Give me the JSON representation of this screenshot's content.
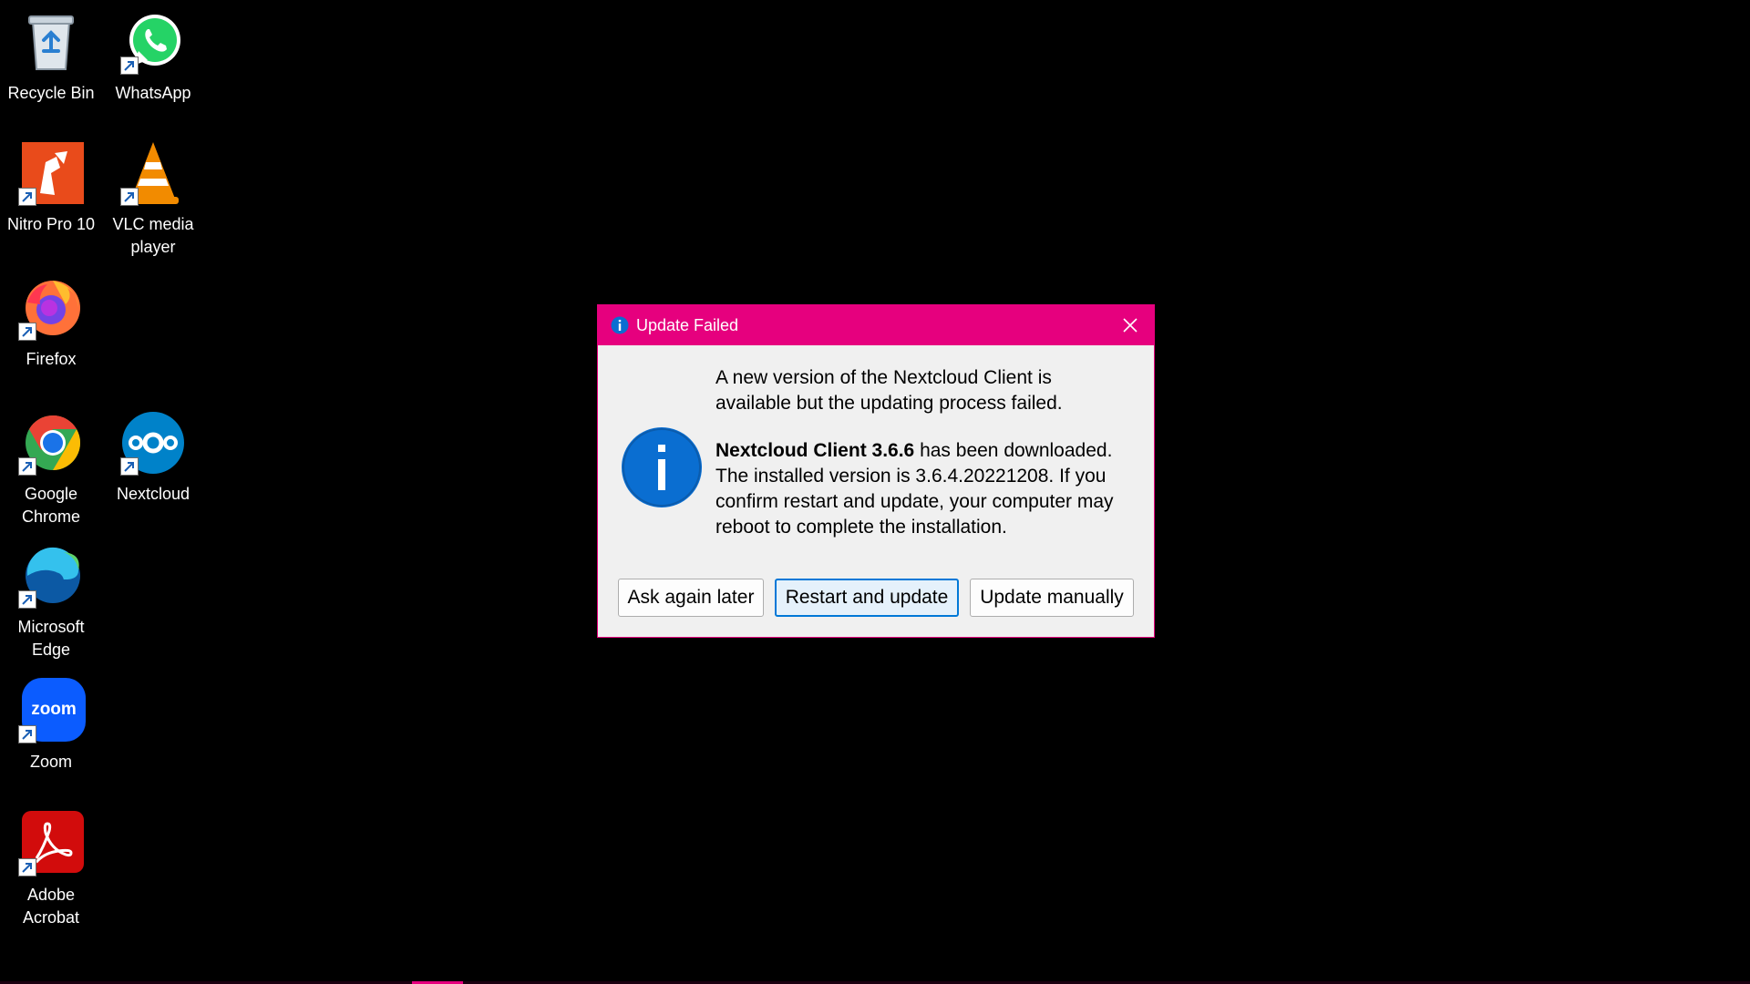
{
  "desktop": {
    "icons": [
      {
        "label": "Recycle Bin",
        "icon": "recycle-bin-icon"
      },
      {
        "label": "WhatsApp",
        "icon": "whatsapp-icon"
      },
      {
        "label": "Nitro Pro 10",
        "icon": "nitro-pro-icon"
      },
      {
        "label": "VLC media player",
        "icon": "vlc-icon"
      },
      {
        "label": "Firefox",
        "icon": "firefox-icon"
      },
      {
        "label": "Google Chrome",
        "icon": "chrome-icon"
      },
      {
        "label": "Nextcloud",
        "icon": "nextcloud-icon"
      },
      {
        "label": "Microsoft Edge",
        "icon": "edge-icon"
      },
      {
        "label": "Zoom",
        "icon": "zoom-icon"
      },
      {
        "label": "Adobe Acrobat",
        "icon": "acrobat-icon"
      }
    ],
    "zoom_logo_text": "zoom"
  },
  "dialog": {
    "title": "Update Failed",
    "message_line1": "A new version of the Nextcloud Client is available but the updating process failed.",
    "product_bold": "Nextcloud Client 3.6.6",
    "message_line2": " has been downloaded. The installed version is 3.6.4.20221208. If you confirm restart and update, your computer may reboot to complete the installation.",
    "buttons": {
      "ask_later": "Ask again later",
      "restart": "Restart and update",
      "manual": "Update manually"
    }
  },
  "colors": {
    "accent": "#e6007e",
    "info_blue": "#0a6ed1",
    "default_button_border": "#0078d7"
  }
}
